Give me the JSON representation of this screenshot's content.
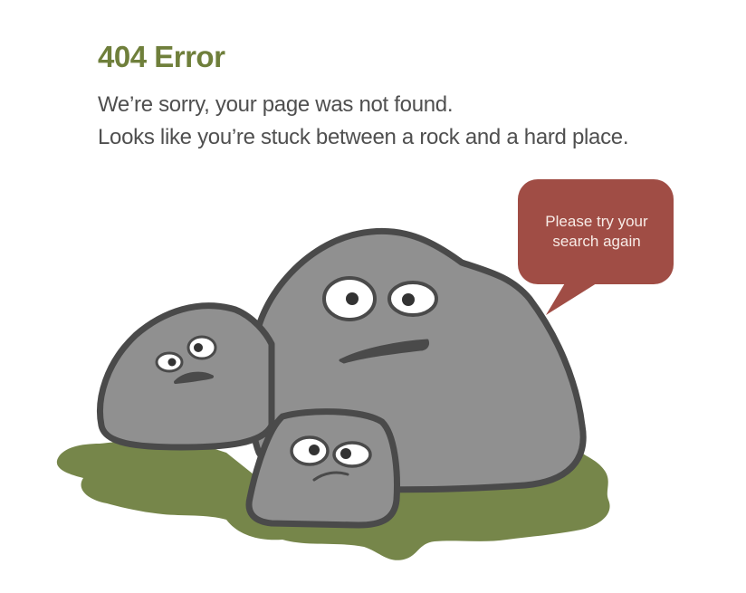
{
  "heading": "404 Error",
  "message": {
    "line1": "We’re sorry, your page was not found.",
    "line2": "Looks like you’re stuck between a rock and a hard place."
  },
  "speech_bubble": {
    "line1": "Please try your",
    "line2": "search again"
  },
  "colors": {
    "heading": "#6f7f3b",
    "text": "#4f4f4f",
    "grass": "#76864a",
    "rock": "#909090",
    "rock_outline": "#4a4a4a",
    "bubble": "#a04d45",
    "bubble_text": "#f7ebe6"
  }
}
